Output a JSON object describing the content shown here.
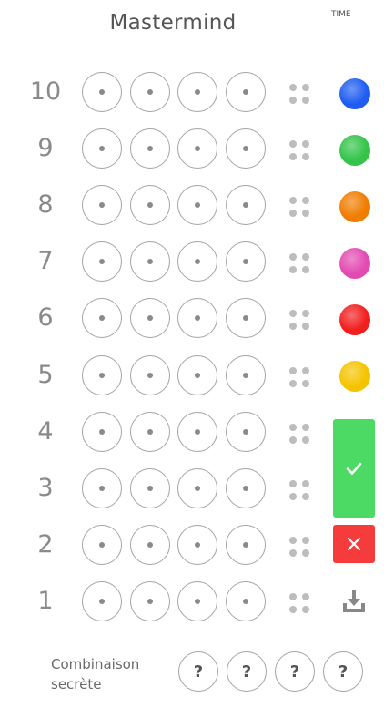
{
  "header": {
    "title": "Mastermind",
    "time_label": "TIME"
  },
  "board": {
    "rows": [
      {
        "number": "10"
      },
      {
        "number": "9"
      },
      {
        "number": "8"
      },
      {
        "number": "7"
      },
      {
        "number": "6"
      },
      {
        "number": "5"
      },
      {
        "number": "4"
      },
      {
        "number": "3"
      },
      {
        "number": "2"
      },
      {
        "number": "1"
      }
    ],
    "pegs_per_row": 4
  },
  "palette": [
    {
      "name": "blue",
      "color": "#1f5df2"
    },
    {
      "name": "green",
      "color": "#34c44a"
    },
    {
      "name": "orange",
      "color": "#f07d00"
    },
    {
      "name": "pink",
      "color": "#e24bb2"
    },
    {
      "name": "red",
      "color": "#f21f1f"
    },
    {
      "name": "yellow",
      "color": "#f5c400"
    }
  ],
  "controls": {
    "validate_color": "#4cd964",
    "cancel_color": "#f53b3b",
    "download_color": "#888888",
    "validate_icon": "check-icon",
    "cancel_icon": "close-icon",
    "download_icon": "download-icon"
  },
  "secret": {
    "label_line1": "Combinaison",
    "label_line2": "secrète",
    "slots": [
      "?",
      "?",
      "?",
      "?"
    ]
  },
  "colors": {
    "peg_border": "#a4a4a4",
    "hint_dot": "#bdbdbd",
    "text": "#555555"
  }
}
